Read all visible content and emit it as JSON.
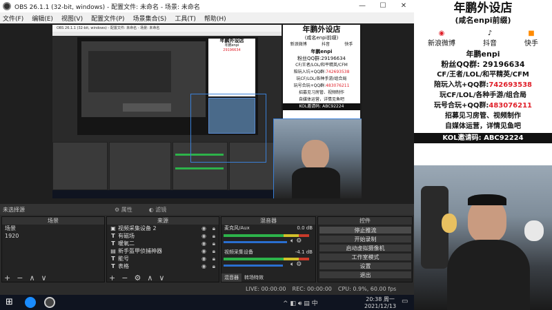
{
  "window": {
    "title": "OBS 26.1.1 (32-bit, windows) - 配置文件: 未命名 - 场景: 未命名",
    "menu": [
      "文件(F)",
      "编辑(E)",
      "视图(V)",
      "配置文件(P)",
      "场景集合(S)",
      "工具(T)",
      "帮助(H)"
    ]
  },
  "nested": {
    "title": "OBS 26.1.1 (32-bit, windows) - 配置文件: 未命名 - 场景: 未命名"
  },
  "promo": {
    "title": "年鹏外设店",
    "subtitle": "(咸名enpi前缀)",
    "links": [
      "新浪微博",
      "抖音",
      "快手"
    ],
    "handle": "年鹏enpi",
    "qq_label": "粉丝QQ群:",
    "qq": "29196634",
    "line1": "CF/王者/LOL/和平精英/CFM",
    "line2_label": "陪玩入坑+QQ群:",
    "line2": "742693538",
    "line3": "玩CF/LOL/各种手游/组合局",
    "line4_label": "玩号合玩+QQ群:",
    "line4": "483076211",
    "line5": "招募见习房管、视频制作",
    "line6": "自媒体运营，详情见鱼吧",
    "kol": "KOL邀请码: ABC92224"
  },
  "statusstrip": {
    "no_source": "未选择源",
    "props": "属性",
    "filters": "滤镜"
  },
  "scenes": {
    "header": "场景",
    "items": [
      "场景",
      "1920"
    ]
  },
  "sources": {
    "header": "来源",
    "items": [
      {
        "icon": "camera",
        "label": "视频采集设备 2"
      },
      {
        "icon": "text",
        "label": "有磁场"
      },
      {
        "icon": "text",
        "label": "暖氧二"
      },
      {
        "icon": "image",
        "label": "新手盔甲侦捕神器"
      },
      {
        "icon": "text",
        "label": "能号"
      },
      {
        "icon": "text",
        "label": "表格"
      }
    ]
  },
  "mixer": {
    "header": "混音器",
    "ch1": {
      "name": "麦克风/Aux",
      "db": "0.0 dB"
    },
    "ch2": {
      "name": "视频采集设备",
      "db": "-4.1 dB"
    },
    "tabs": [
      "混音器",
      "转场特效"
    ]
  },
  "controls": {
    "header": "控件",
    "buttons": [
      "停止推流",
      "开始录制",
      "启动虚拟摄像机",
      "工作室模式",
      "设置",
      "退出"
    ]
  },
  "statusbar": {
    "live": "LIVE: 00:00:00",
    "rec": "REC: 00:00:00",
    "cpu": "CPU: 0.9%, 60.00 fps"
  },
  "taskbar": {
    "time": "20:38 周一",
    "date": "2021/12/13",
    "ime": "中"
  }
}
